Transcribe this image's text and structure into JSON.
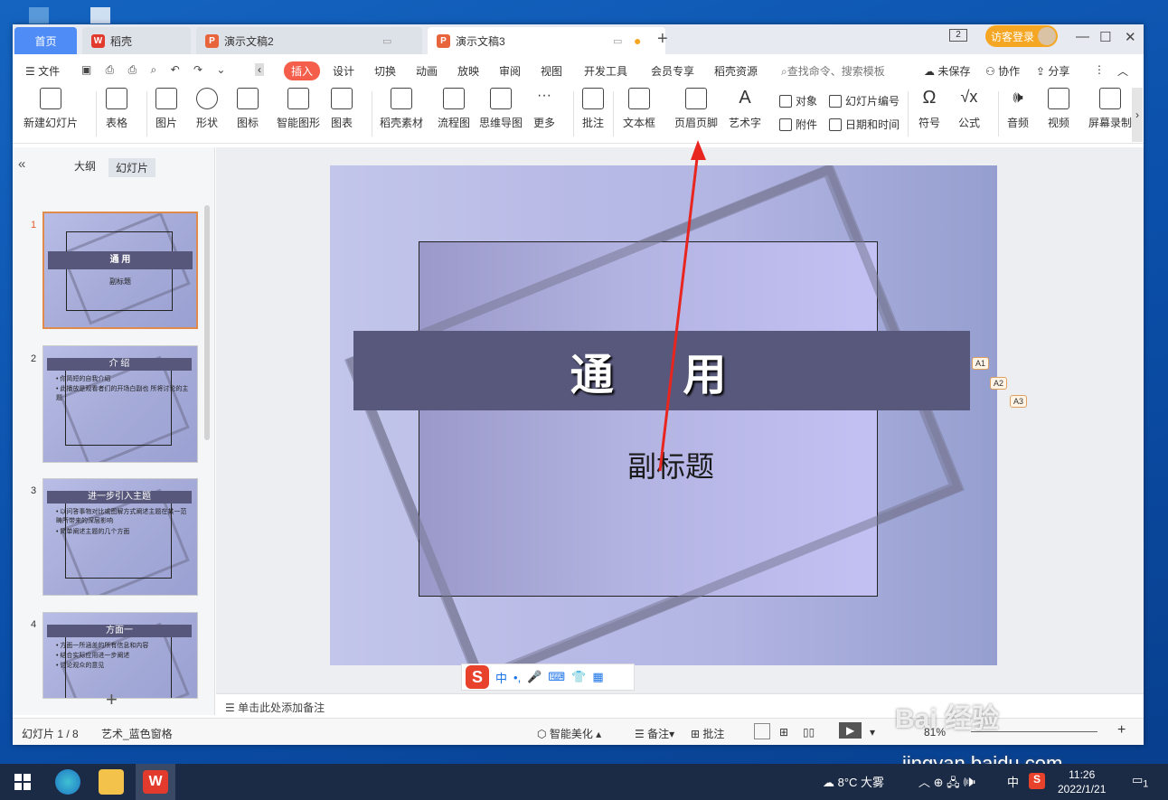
{
  "titlebar": {
    "tabs": [
      {
        "label": "首页"
      },
      {
        "label": "稻壳"
      },
      {
        "label": "演示文稿2"
      },
      {
        "label": "演示文稿3"
      }
    ],
    "login": "访客登录",
    "badge": "2"
  },
  "menu": {
    "items": [
      "文件",
      "插入",
      "设计",
      "切换",
      "动画",
      "放映",
      "审阅",
      "视图",
      "开发工具",
      "会员专享",
      "稻壳资源"
    ],
    "search": "查找命令、搜索模板",
    "unsaved": "未保存",
    "collab": "协作",
    "share": "分享"
  },
  "ribbon": {
    "buttons": [
      "新建幻灯片",
      "表格",
      "图片",
      "形状",
      "图标",
      "智能图形",
      "图表",
      "稻壳素材",
      "流程图",
      "思维导图",
      "更多",
      "批注",
      "文本框",
      "页眉页脚",
      "艺术字",
      "符号",
      "公式",
      "音频",
      "视频",
      "屏幕录制"
    ],
    "small": [
      "对象",
      "幻灯片编号",
      "附件",
      "日期和时间"
    ]
  },
  "leftpanel": {
    "tab_outline": "大纲",
    "tab_slides": "幻灯片",
    "slides": [
      {
        "num": "1",
        "title": "通 用",
        "sub": "副标题"
      },
      {
        "num": "2",
        "title": "介 绍",
        "bullets": [
          "• 你简短的自我介绍",
          "• 此播放是观看者们的开场白副也 所将讨论的主题"
        ]
      },
      {
        "num": "3",
        "title": "进一步引入主题",
        "bullets": [
          "• 以问答事物对比或图解方式阐述主题在某一范畴所带来的深层影响",
          "• 简单阐述主题的几个方面"
        ]
      },
      {
        "num": "4",
        "title": "方面一",
        "bullets": [
          "• 方面一所涵盖的所有信息和内容",
          "• 结合实际应用进一步阐述",
          "• 讨论观众的意见"
        ]
      }
    ]
  },
  "slide": {
    "title": "通 用",
    "subtitle": "副标题",
    "tags": [
      "A1",
      "A2",
      "A3"
    ]
  },
  "notes": "单击此处添加备注",
  "status": {
    "page": "幻灯片 1 / 8",
    "theme": "艺术_蓝色窗格",
    "beautify": "智能美化",
    "notes": "备注",
    "comment": "批注",
    "zoom": "81%"
  },
  "ime": {
    "cn": "中"
  },
  "taskbar": {
    "weather": "8°C  大雾",
    "time": "11:26",
    "date": "2022/1/21",
    "notif": "1",
    "lang": "中"
  },
  "watermark": {
    "main": "Bai 经验",
    "url": "jingyan.baidu.com"
  }
}
